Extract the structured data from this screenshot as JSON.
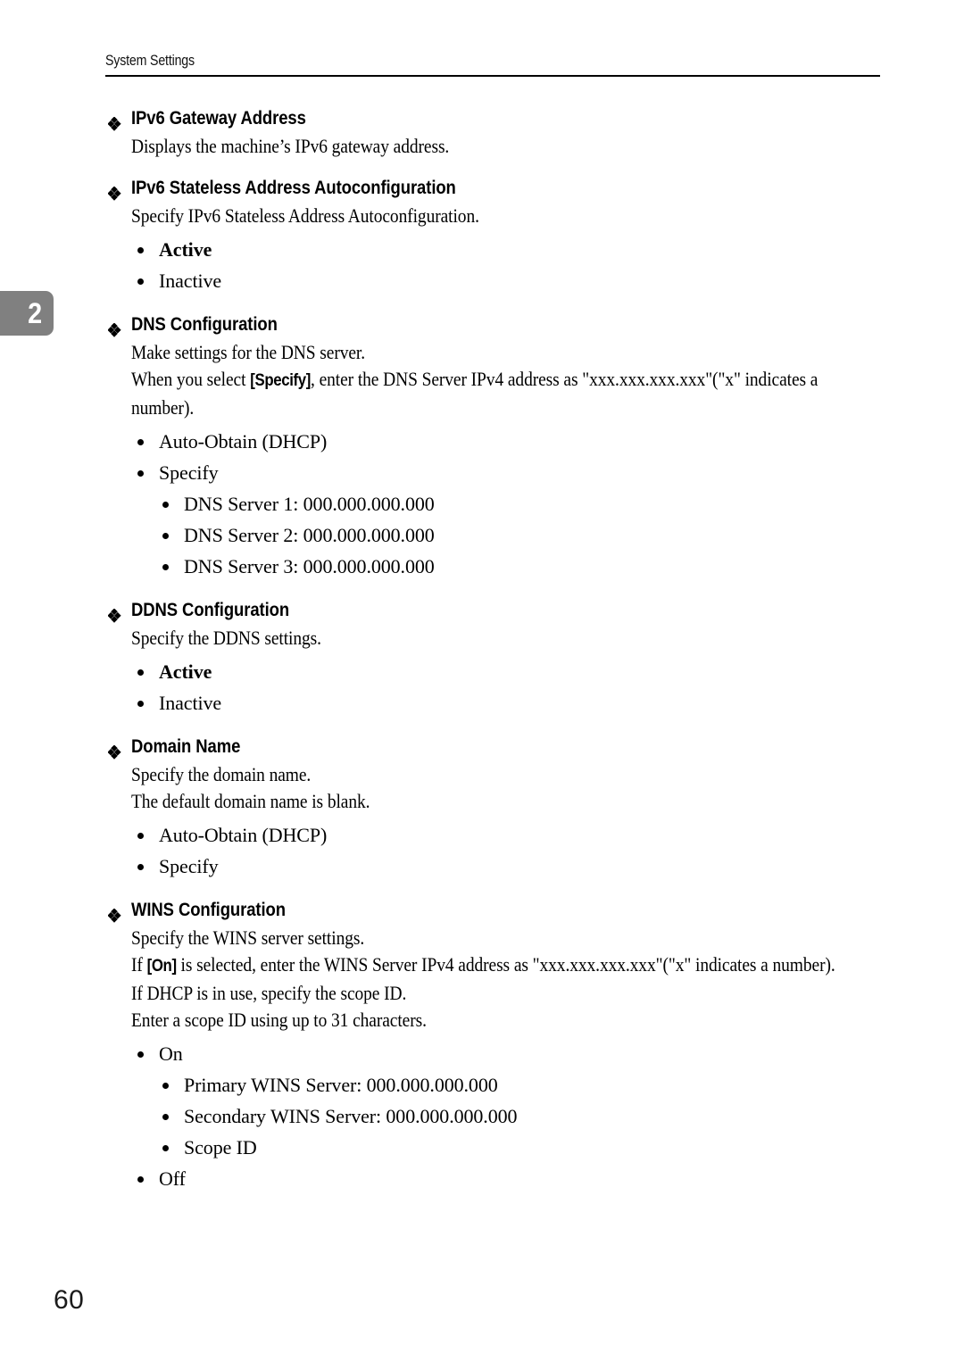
{
  "page": {
    "running_header": "System Settings",
    "chapter_tab_number": "2",
    "folio": "60",
    "colors": {
      "chapter_tab_background": "#808080",
      "chapter_tab_number": "#ffffff",
      "text": "#000000",
      "rule": "#000000"
    }
  },
  "sections": [
    {
      "heading": "IPv6 Gateway Address",
      "paragraphs": [
        "Displays the machine’s IPv6 gateway address."
      ],
      "items": []
    },
    {
      "heading": "IPv6 Stateless Address Autoconfiguration",
      "paragraphs": [
        "Specify IPv6 Stateless Address Autoconfiguration."
      ],
      "items": [
        {
          "label": "Active",
          "bold": true,
          "children": []
        },
        {
          "label": "Inactive",
          "bold": false,
          "children": []
        }
      ]
    },
    {
      "heading": "DNS Configuration",
      "paragraphs": [
        "Make settings for the DNS server."
      ],
      "rich_paragraph": {
        "before": "When you select ",
        "key": "[Specify]",
        "after": ", enter the DNS Server IPv4 address as \"xxx.xxx.xxx.xxx\"(\"x\" indicates a number)."
      },
      "items": [
        {
          "label": "Auto-Obtain (DHCP)",
          "bold": false,
          "children": []
        },
        {
          "label": "Specify",
          "bold": false,
          "children": [
            "DNS Server 1: 000.000.000.000",
            "DNS Server 2: 000.000.000.000",
            "DNS Server 3: 000.000.000.000"
          ]
        }
      ]
    },
    {
      "heading": "DDNS Configuration",
      "paragraphs": [
        "Specify the DDNS settings."
      ],
      "items": [
        {
          "label": "Active",
          "bold": true,
          "children": []
        },
        {
          "label": "Inactive",
          "bold": false,
          "children": []
        }
      ]
    },
    {
      "heading": "Domain Name",
      "paragraphs": [
        "Specify the domain name.",
        "The default domain name is blank."
      ],
      "items": [
        {
          "label": "Auto-Obtain (DHCP)",
          "bold": false,
          "children": []
        },
        {
          "label": "Specify",
          "bold": false,
          "children": []
        }
      ]
    },
    {
      "heading": "WINS Configuration",
      "paragraphs": [
        "Specify the WINS server settings."
      ],
      "rich_paragraph": {
        "before": "If ",
        "key": "[On]",
        "after": " is selected, enter the WINS Server IPv4 address as \"xxx.xxx.xxx.xxx\"(\"x\" indicates a number)."
      },
      "paragraphs_after": [
        "If DHCP is in use, specify the scope ID.",
        "Enter a scope ID using up to 31 characters."
      ],
      "items": [
        {
          "label": "On",
          "bold": false,
          "children": [
            "Primary WINS Server: 000.000.000.000",
            "Secondary WINS Server: 000.000.000.000",
            "Scope ID"
          ]
        },
        {
          "label": "Off",
          "bold": false,
          "children": []
        }
      ]
    }
  ]
}
